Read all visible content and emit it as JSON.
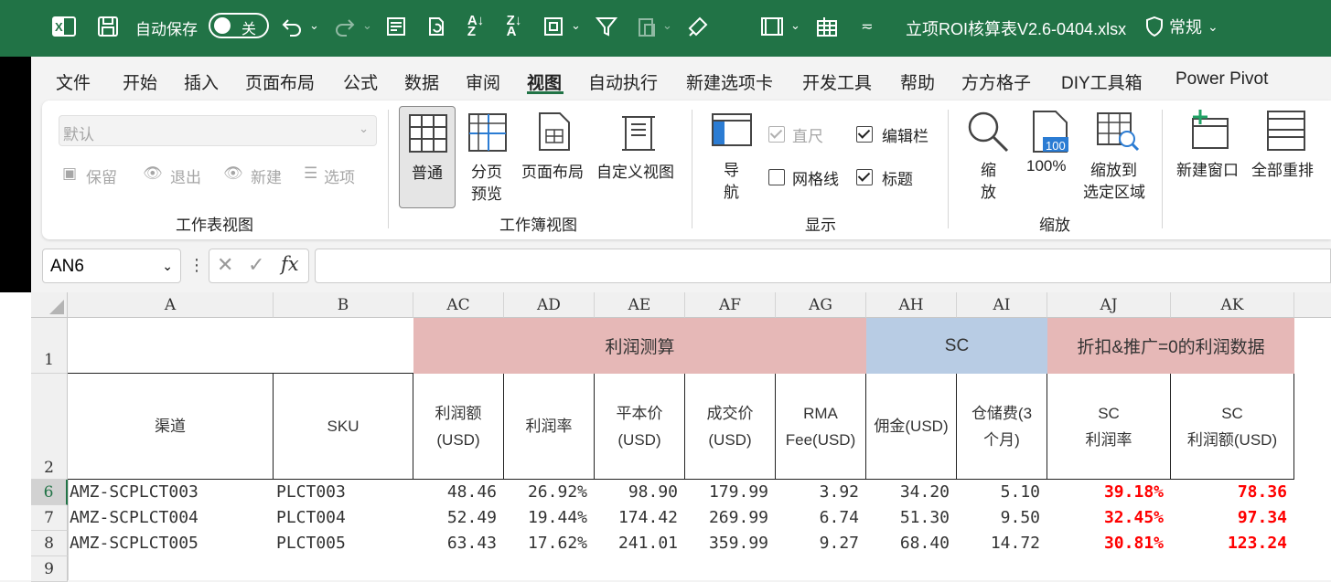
{
  "titlebar": {
    "autosave_label": "自动保存",
    "autosave_state": "关",
    "file_title": "立项ROI核算表V2.6-0404.xlsx",
    "sensitivity": "常规"
  },
  "tabs": [
    "文件",
    "开始",
    "插入",
    "页面布局",
    "公式",
    "数据",
    "审阅",
    "视图",
    "自动执行",
    "新建选项卡",
    "开发工具",
    "帮助",
    "方方格子",
    "DIY工具箱",
    "Power Pivot"
  ],
  "active_tab": "视图",
  "ribbon": {
    "sheet_view": {
      "dropdown_value": "默认",
      "keep": "保留",
      "exit": "退出",
      "new": "新建",
      "options": "选项",
      "label": "工作表视图"
    },
    "workbook_view": {
      "normal": "普通",
      "page_break_1": "分页",
      "page_break_2": "预览",
      "page_layout": "页面布局",
      "custom": "自定义视图",
      "label": "工作簿视图"
    },
    "show": {
      "nav_1": "导",
      "nav_2": "航",
      "ruler": "直尺",
      "formula_bar": "编辑栏",
      "gridlines": "网格线",
      "headings": "标题",
      "label": "显示"
    },
    "zoom": {
      "zoom_1": "缩",
      "zoom_2": "放",
      "hundred": "100%",
      "hundred_badge": "100",
      "to_sel_1": "缩放到",
      "to_sel_2": "选定区域",
      "label": "缩放"
    },
    "window": {
      "new_window": "新建窗口",
      "arrange_all": "全部重排"
    }
  },
  "formula_bar": {
    "namebox": "AN6",
    "fx": "fx",
    "content": ""
  },
  "grid": {
    "columns": [
      "A",
      "B",
      "AC",
      "AD",
      "AE",
      "AF",
      "AG",
      "AH",
      "AI",
      "AJ",
      "AK"
    ],
    "row_numbers": [
      "1",
      "2",
      "6",
      "7",
      "8",
      "9"
    ],
    "group_headers": {
      "profit": "利润测算",
      "sc": "SC",
      "zero": "折扣&推广=0的利润数据"
    },
    "colors": {
      "profit_bg": "#e6b8b7",
      "sc_bg": "#b8cce4",
      "zero_bg": "#e6b8b7",
      "highlight": "#ff0000"
    },
    "headers": [
      [
        "渠道"
      ],
      [
        "SKU"
      ],
      [
        "利润额",
        "(USD)"
      ],
      [
        "利润率"
      ],
      [
        "平本价",
        "(USD)"
      ],
      [
        "成交价",
        "(USD)"
      ],
      [
        "RMA",
        "Fee(USD)"
      ],
      [
        "佣金(USD)"
      ],
      [
        "仓储费(3",
        "个月)"
      ],
      [
        "SC",
        "利润率"
      ],
      [
        "SC",
        "利润额(USD)"
      ]
    ],
    "rows": [
      [
        "AMZ-SCPLCT003",
        "PLCT003",
        "48.46",
        "26.92%",
        "98.90",
        "179.99",
        "3.92",
        "34.20",
        "5.10",
        "39.18%",
        "78.36"
      ],
      [
        "AMZ-SCPLCT004",
        "PLCT004",
        "52.49",
        "19.44%",
        "174.42",
        "269.99",
        "6.74",
        "51.30",
        "9.50",
        "32.45%",
        "97.34"
      ],
      [
        "AMZ-SCPLCT005",
        "PLCT005",
        "63.43",
        "17.62%",
        "241.01",
        "359.99",
        "9.27",
        "68.40",
        "14.72",
        "30.81%",
        "123.24"
      ]
    ]
  }
}
